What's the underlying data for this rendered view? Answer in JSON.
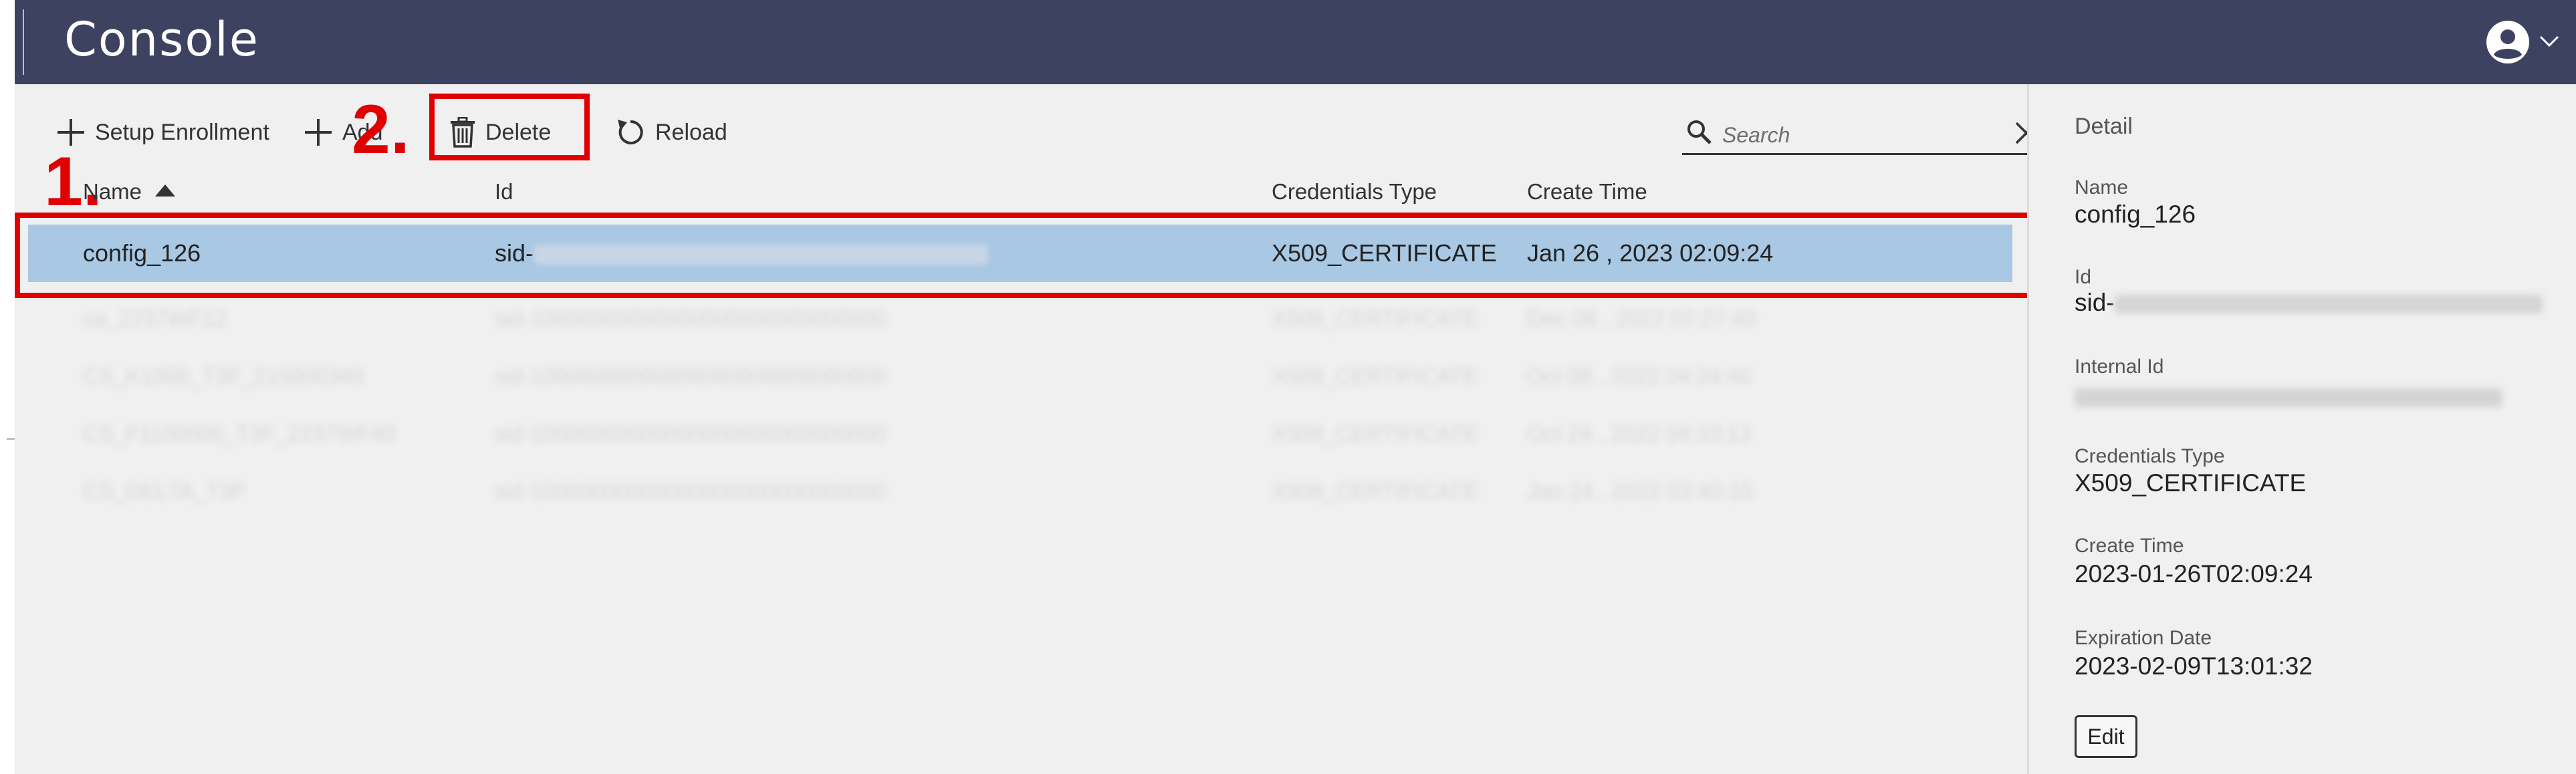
{
  "app": {
    "title": "Console"
  },
  "toolbar": {
    "setup_enrollment": "Setup Enrollment",
    "add": "Add",
    "delete": "Delete",
    "reload": "Reload"
  },
  "search": {
    "placeholder": "Search",
    "value": ""
  },
  "annotations": {
    "step1": "1.",
    "step2": "2."
  },
  "table": {
    "columns": [
      "Name",
      "Id",
      "Credentials Type",
      "Create Time"
    ],
    "sort": {
      "column": "Name",
      "direction": "ascending"
    },
    "rows": [
      {
        "name": "config_126",
        "id": "sid-",
        "credentials_type": "X509_CERTIFICATE",
        "create_time": "Jan 26 , 2023 02:09:24",
        "selected": true
      },
      {
        "name": "ca_2237WF12",
        "id": "sid-10000000000000000000000000000",
        "credentials_type": "X509_CERTIFICATE",
        "create_time": "Dec 08 , 2022 07:27:40",
        "selected": false
      },
      {
        "name": "CS_K1000_T3F_215000345",
        "id": "sid-10000000000000000000000000000",
        "credentials_type": "X509_CERTIFICATE",
        "create_time": "Oct 08 , 2022 04:24:40",
        "selected": false
      },
      {
        "name": "CS_F1100000_T3F_2237WF40",
        "id": "sid-10000000000000000000000000000",
        "credentials_type": "X509_CERTIFICATE",
        "create_time": "Oct 24 , 2022 04:33:13",
        "selected": false
      },
      {
        "name": "CS_DELTA_T3F",
        "id": "sid-10000000000000000000000000000",
        "credentials_type": "X509_CERTIFICATE",
        "create_time": "Jan 24 , 2022 03:40:15",
        "selected": false
      }
    ]
  },
  "detail": {
    "title": "Detail",
    "name_label": "Name",
    "name_value": "config_126",
    "id_label": "Id",
    "id_value": "sid-",
    "internal_id_label": "Internal Id",
    "credentials_type_label": "Credentials Type",
    "credentials_type_value": "X509_CERTIFICATE",
    "create_time_label": "Create Time",
    "create_time_value": "2023-01-26T02:09:24",
    "expiration_date_label": "Expiration Date",
    "expiration_date_value": "2023-02-09T13:01:32",
    "edit_label": "Edit"
  },
  "colors": {
    "topbar": "#3d4260",
    "selected_row": "#a9c8e3",
    "annotation": "#e00000",
    "background": "#f0f0f0"
  },
  "icons": {
    "user": "user-circle-icon",
    "menu": "chevron-down-icon",
    "setup": "plus-icon",
    "add": "plus-icon",
    "delete": "trash-icon",
    "reload": "reload-icon",
    "search": "magnifier-icon",
    "clear": "close-icon"
  }
}
